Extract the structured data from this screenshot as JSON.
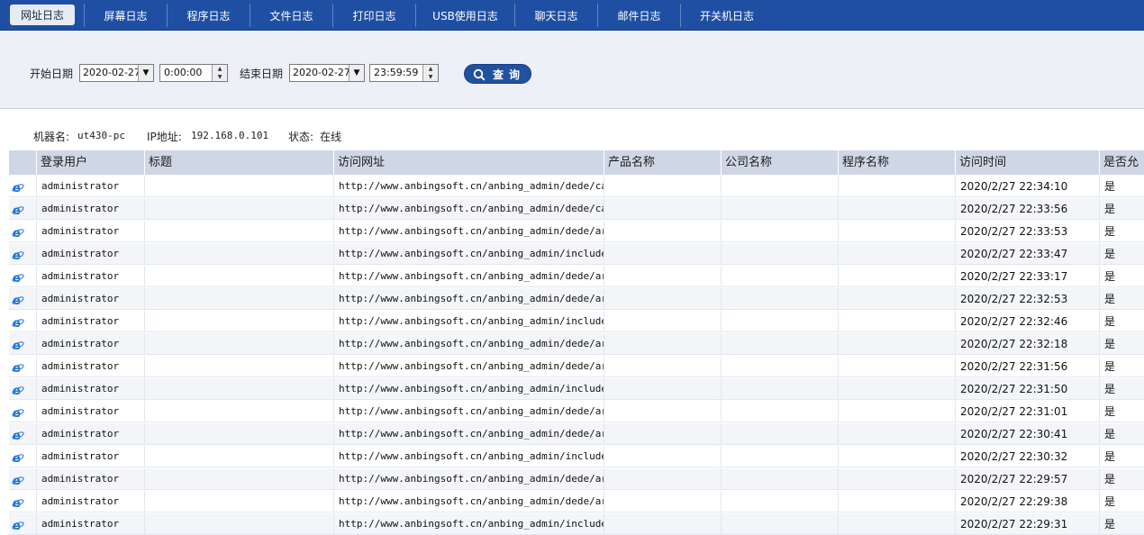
{
  "tabs": [
    {
      "label": "网址日志",
      "active": true
    },
    {
      "label": "屏幕日志",
      "active": false
    },
    {
      "label": "程序日志",
      "active": false
    },
    {
      "label": "文件日志",
      "active": false
    },
    {
      "label": "打印日志",
      "active": false
    },
    {
      "label": "USB使用日志",
      "active": false
    },
    {
      "label": "聊天日志",
      "active": false
    },
    {
      "label": "邮件日志",
      "active": false
    },
    {
      "label": "开关机日志",
      "active": false
    }
  ],
  "filter": {
    "start_label": "开始日期",
    "start_date": "2020-02-27",
    "start_time": "0:00:00",
    "end_label": "结束日期",
    "end_date": "2020-02-27",
    "end_time": "23:59:59",
    "query_label": "查询"
  },
  "machine": {
    "name_label": "机器名:",
    "name": "ut430-pc",
    "ip_label": "IP地址:",
    "ip": "192.168.0.101",
    "status_label": "状态:",
    "status": "在线"
  },
  "table": {
    "columns": [
      "登录用户",
      "标题",
      "访问网址",
      "产品名称",
      "公司名称",
      "程序名称",
      "访问时间",
      "是否允"
    ],
    "rows": [
      {
        "user": "administrator",
        "title": "",
        "url": "http://www.anbingsoft.cn/anbing_admin/dede/ca...",
        "product": "",
        "company": "",
        "program": "",
        "time": "2020/2/27 22:34:10",
        "allowed": "是"
      },
      {
        "user": "administrator",
        "title": "",
        "url": "http://www.anbingsoft.cn/anbing_admin/dede/ca...",
        "product": "",
        "company": "",
        "program": "",
        "time": "2020/2/27 22:33:56",
        "allowed": "是"
      },
      {
        "user": "administrator",
        "title": "",
        "url": "http://www.anbingsoft.cn/anbing_admin/dede/ar...",
        "product": "",
        "company": "",
        "program": "",
        "time": "2020/2/27 22:33:53",
        "allowed": "是"
      },
      {
        "user": "administrator",
        "title": "",
        "url": "http://www.anbingsoft.cn/anbing_admin/include...",
        "product": "",
        "company": "",
        "program": "",
        "time": "2020/2/27 22:33:47",
        "allowed": "是"
      },
      {
        "user": "administrator",
        "title": "",
        "url": "http://www.anbingsoft.cn/anbing_admin/dede/ar...",
        "product": "",
        "company": "",
        "program": "",
        "time": "2020/2/27 22:33:17",
        "allowed": "是"
      },
      {
        "user": "administrator",
        "title": "",
        "url": "http://www.anbingsoft.cn/anbing_admin/dede/ar...",
        "product": "",
        "company": "",
        "program": "",
        "time": "2020/2/27 22:32:53",
        "allowed": "是"
      },
      {
        "user": "administrator",
        "title": "",
        "url": "http://www.anbingsoft.cn/anbing_admin/include...",
        "product": "",
        "company": "",
        "program": "",
        "time": "2020/2/27 22:32:46",
        "allowed": "是"
      },
      {
        "user": "administrator",
        "title": "",
        "url": "http://www.anbingsoft.cn/anbing_admin/dede/ar...",
        "product": "",
        "company": "",
        "program": "",
        "time": "2020/2/27 22:32:18",
        "allowed": "是"
      },
      {
        "user": "administrator",
        "title": "",
        "url": "http://www.anbingsoft.cn/anbing_admin/dede/ar...",
        "product": "",
        "company": "",
        "program": "",
        "time": "2020/2/27 22:31:56",
        "allowed": "是"
      },
      {
        "user": "administrator",
        "title": "",
        "url": "http://www.anbingsoft.cn/anbing_admin/include...",
        "product": "",
        "company": "",
        "program": "",
        "time": "2020/2/27 22:31:50",
        "allowed": "是"
      },
      {
        "user": "administrator",
        "title": "",
        "url": "http://www.anbingsoft.cn/anbing_admin/dede/ar...",
        "product": "",
        "company": "",
        "program": "",
        "time": "2020/2/27 22:31:01",
        "allowed": "是"
      },
      {
        "user": "administrator",
        "title": "",
        "url": "http://www.anbingsoft.cn/anbing_admin/dede/ar...",
        "product": "",
        "company": "",
        "program": "",
        "time": "2020/2/27 22:30:41",
        "allowed": "是"
      },
      {
        "user": "administrator",
        "title": "",
        "url": "http://www.anbingsoft.cn/anbing_admin/include...",
        "product": "",
        "company": "",
        "program": "",
        "time": "2020/2/27 22:30:32",
        "allowed": "是"
      },
      {
        "user": "administrator",
        "title": "",
        "url": "http://www.anbingsoft.cn/anbing_admin/dede/ar...",
        "product": "",
        "company": "",
        "program": "",
        "time": "2020/2/27 22:29:57",
        "allowed": "是"
      },
      {
        "user": "administrator",
        "title": "",
        "url": "http://www.anbingsoft.cn/anbing_admin/dede/ar...",
        "product": "",
        "company": "",
        "program": "",
        "time": "2020/2/27 22:29:38",
        "allowed": "是"
      },
      {
        "user": "administrator",
        "title": "",
        "url": "http://www.anbingsoft.cn/anbing_admin/include...",
        "product": "",
        "company": "",
        "program": "",
        "time": "2020/2/27 22:29:31",
        "allowed": "是"
      }
    ]
  },
  "colors": {
    "tabbar": "#1f4fa3",
    "header_row": "#cfd7e6",
    "query_button": "#21519f",
    "ie_icon": "#1e73d8"
  },
  "icons": {
    "row_icon": "ie-browser-icon",
    "query_icon": "search-icon"
  }
}
